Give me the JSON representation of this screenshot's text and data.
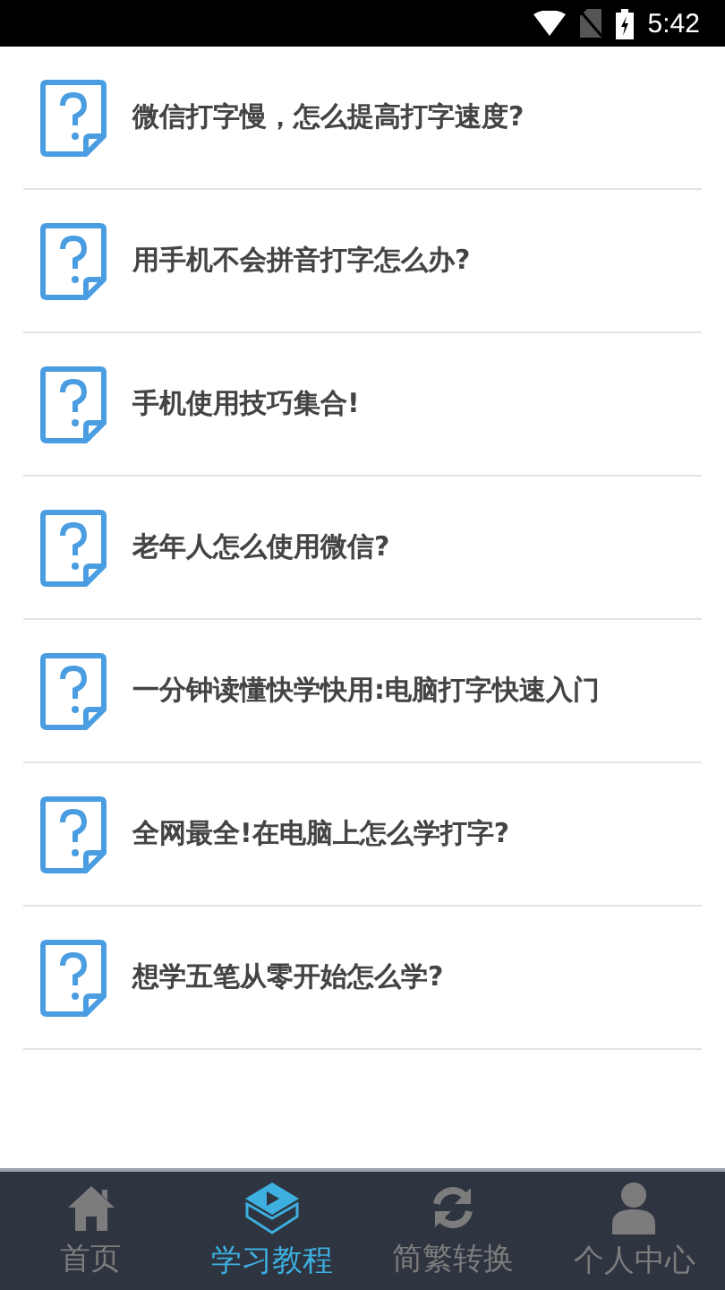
{
  "status_bar": {
    "time": "5:42"
  },
  "articles": [
    {
      "title": "微信打字慢，怎么提高打字速度?"
    },
    {
      "title": "用手机不会拼音打字怎么办?"
    },
    {
      "title": "手机使用技巧集合!"
    },
    {
      "title": "老年人怎么使用微信?"
    },
    {
      "title": "一分钟读懂快学快用:电脑打字快速入门"
    },
    {
      "title": "全网最全!在电脑上怎么学打字?"
    },
    {
      "title": "想学五笔从零开始怎么学?"
    }
  ],
  "tabs": [
    {
      "label": "首页",
      "kind": "home",
      "selected": false
    },
    {
      "label": "学习教程",
      "kind": "play",
      "selected": true
    },
    {
      "label": "简繁转换",
      "kind": "sync",
      "selected": false
    },
    {
      "label": "个人中心",
      "kind": "person",
      "selected": false
    }
  ]
}
